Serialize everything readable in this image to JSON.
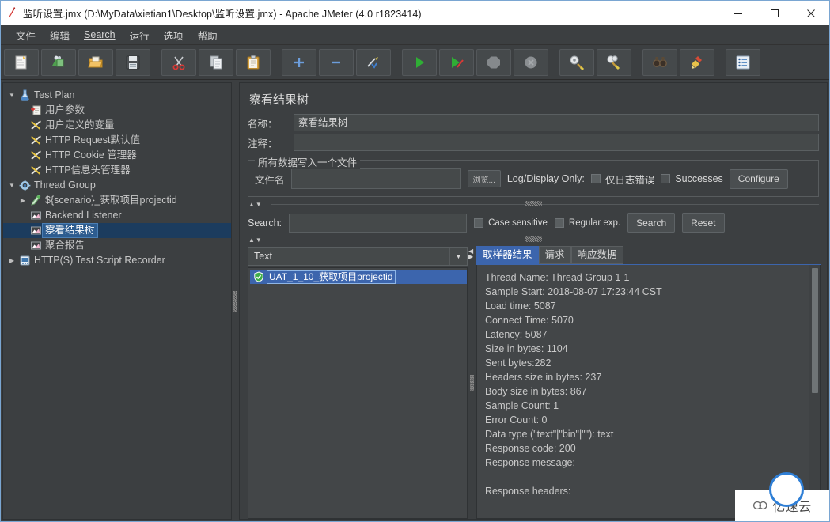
{
  "window": {
    "title": "监听设置.jmx (D:\\MyData\\xietian1\\Desktop\\监听设置.jmx) - Apache JMeter (4.0 r1823414)",
    "app_icon": "jmeter-feather-icon",
    "minimize": "—",
    "maximize": "□",
    "close": "✕"
  },
  "menubar": {
    "items": [
      {
        "label": "文件",
        "name": "menu-file"
      },
      {
        "label": "编辑",
        "name": "menu-edit"
      },
      {
        "label": "Search",
        "name": "menu-search",
        "underline_first": true
      },
      {
        "label": "运行",
        "name": "menu-run"
      },
      {
        "label": "选项",
        "name": "menu-options"
      },
      {
        "label": "帮助",
        "name": "menu-help"
      }
    ]
  },
  "toolbar": {
    "buttons": [
      {
        "name": "new-button",
        "icon": "new-document-icon"
      },
      {
        "name": "templates-button",
        "icon": "templates-icon"
      },
      {
        "name": "open-button",
        "icon": "open-folder-icon"
      },
      {
        "name": "save-button",
        "icon": "save-floppy-icon"
      },
      {
        "name": "cut-button",
        "icon": "scissors-icon"
      },
      {
        "name": "copy-button",
        "icon": "copy-pages-icon"
      },
      {
        "name": "paste-button",
        "icon": "clipboard-icon"
      },
      {
        "name": "expand-all-button",
        "icon": "plus-icon"
      },
      {
        "name": "collapse-all-button",
        "icon": "minus-icon"
      },
      {
        "name": "toggle-button",
        "icon": "toggle-pencil-icon"
      },
      {
        "name": "start-button",
        "icon": "play-green-icon"
      },
      {
        "name": "start-no-timers-button",
        "icon": "play-no-timers-icon"
      },
      {
        "name": "stop-button",
        "icon": "stop-octagon-icon"
      },
      {
        "name": "shutdown-button",
        "icon": "shutdown-circle-icon"
      },
      {
        "name": "clear-button",
        "icon": "clear-broom-icon"
      },
      {
        "name": "clear-all-button",
        "icon": "clear-all-broom-icon"
      },
      {
        "name": "search-button",
        "icon": "binoculars-icon"
      },
      {
        "name": "reset-search-button",
        "icon": "reset-broom-icon"
      },
      {
        "name": "function-helper-button",
        "icon": "list-lines-icon"
      }
    ]
  },
  "tree": {
    "nodes": [
      {
        "label": "Test Plan",
        "indent": 0,
        "twisty": "down",
        "icon": "test-plan-icon",
        "selected": false,
        "name": "tree-node-test-plan"
      },
      {
        "label": "用户参数",
        "indent": 1,
        "twisty": "none",
        "icon": "user-params-icon",
        "selected": false,
        "name": "tree-node-user-parameters"
      },
      {
        "label": "用户定义的变量",
        "indent": 1,
        "twisty": "none",
        "icon": "config-element-icon",
        "selected": false,
        "name": "tree-node-user-defined-variables"
      },
      {
        "label": "HTTP Request默认值",
        "indent": 1,
        "twisty": "none",
        "icon": "config-element-icon",
        "selected": false,
        "name": "tree-node-http-request-defaults"
      },
      {
        "label": "HTTP Cookie 管理器",
        "indent": 1,
        "twisty": "none",
        "icon": "config-element-icon",
        "selected": false,
        "name": "tree-node-http-cookie-manager"
      },
      {
        "label": "HTTP信息头管理器",
        "indent": 1,
        "twisty": "none",
        "icon": "config-element-icon",
        "selected": false,
        "name": "tree-node-http-header-manager"
      },
      {
        "label": "Thread Group",
        "indent": 0,
        "twisty": "down",
        "icon": "thread-group-icon",
        "selected": false,
        "name": "tree-node-thread-group"
      },
      {
        "label": "${scenario}_获取项目projectid",
        "indent": 1,
        "twisty": "right",
        "icon": "sampler-icon",
        "selected": false,
        "name": "tree-node-sampler-get-projectid"
      },
      {
        "label": "Backend Listener",
        "indent": 1,
        "twisty": "none",
        "icon": "listener-icon",
        "selected": false,
        "name": "tree-node-backend-listener"
      },
      {
        "label": "察看结果树",
        "indent": 1,
        "twisty": "none",
        "icon": "listener-icon",
        "selected": true,
        "name": "tree-node-view-results-tree"
      },
      {
        "label": "聚合报告",
        "indent": 1,
        "twisty": "none",
        "icon": "listener-icon",
        "selected": false,
        "name": "tree-node-aggregate-report"
      },
      {
        "label": "HTTP(S) Test Script Recorder",
        "indent": 0,
        "twisty": "right",
        "icon": "recorder-icon",
        "selected": false,
        "name": "tree-node-http-script-recorder"
      }
    ]
  },
  "panel": {
    "title": "察看结果树",
    "name_label": "名称：",
    "name_value": "察看结果树",
    "comment_label": "注释：",
    "comment_value": "",
    "file_group": {
      "title": "所有数据写入一个文件",
      "filename_label": "文件名",
      "filename_value": "",
      "browse_label": "浏览...",
      "log_display_label": "Log/Display Only:",
      "errors_only_label": "仅日志错误",
      "errors_only_checked": false,
      "successes_label": "Successes",
      "successes_checked": false,
      "configure_label": "Configure"
    },
    "search": {
      "label": "Search:",
      "value": "",
      "case_sensitive_label": "Case sensitive",
      "case_sensitive_checked": false,
      "regex_label": "Regular exp.",
      "regex_checked": false,
      "search_button": "Search",
      "reset_button": "Reset"
    },
    "renderer": {
      "selected": "Text"
    },
    "results": [
      {
        "label": "UAT_1_10_获取项目projectid",
        "status": "success",
        "selected": true
      }
    ],
    "tabs": [
      {
        "label": "取样器结果",
        "active": true,
        "name": "tab-sampler-result"
      },
      {
        "label": "请求",
        "active": false,
        "name": "tab-request"
      },
      {
        "label": "响应数据",
        "active": false,
        "name": "tab-response-data"
      }
    ],
    "sampler_result_lines": [
      "Thread Name: Thread Group 1-1",
      "Sample Start: 2018-08-07 17:23:44 CST",
      "Load time: 5087",
      "Connect Time: 5070",
      "Latency: 5087",
      "Size in bytes: 1104",
      "Sent bytes:282",
      "Headers size in bytes: 237",
      "Body size in bytes: 867",
      "Sample Count: 1",
      "Error Count: 0",
      "Data type (\"text\"|\"bin\"|\"\"): text",
      "Response code: 200",
      "Response message:",
      "",
      "Response headers:"
    ]
  },
  "watermark": {
    "text": "亿速云",
    "logo": "cloud-logo-icon"
  }
}
